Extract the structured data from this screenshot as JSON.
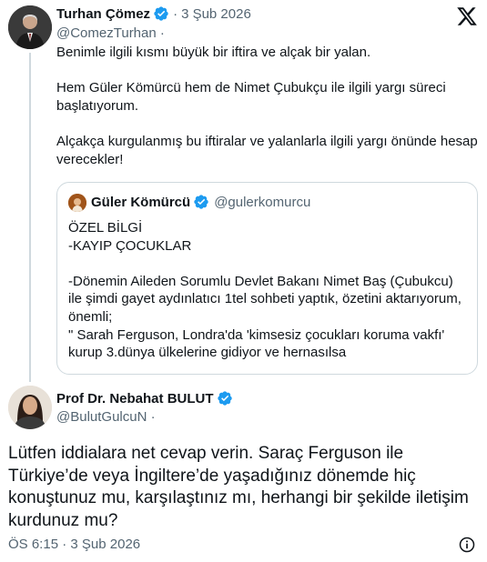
{
  "colors": {
    "verified_badge": "#1d9bf0",
    "text_primary": "#0f1419",
    "text_secondary": "#536471",
    "border": "#cfd9de"
  },
  "icons": {
    "verified": "verified-badge-icon",
    "platform": "x-logo-icon",
    "info": "info-icon"
  },
  "post": {
    "author_name": "Turhan Çömez",
    "dot": "·",
    "date": "3 Şub 2026",
    "handle": "@ComezTurhan",
    "handle_dot": "·",
    "paragraphs": [
      "Benimle ilgili kısmı büyük bir iftira ve alçak bir yalan.",
      "Hem Güler Kömürcü hem de Nimet Çubukçu ile ilgili yargı süreci başlatıyorum.",
      "Alçakça kurgulanmış bu iftiralar ve yalanlarla ilgili yargı önünde hesap verecekler!"
    ],
    "quote": {
      "author_name": "Güler Kömürcü",
      "handle": "@gulerkomurcu",
      "lines": [
        "ÖZEL BİLGİ",
        "-KAYIP ÇOCUKLAR",
        "-Dönemin Aileden Sorumlu Devlet Bakanı Nimet Baş (Çubukcu) ile şimdi gayet aydınlatıcı 1tel sohbeti yaptık, özetini aktarıyorum, önemli;",
        "\" Sarah Ferguson, Londra'da 'kimsesiz çocukları koruma vakfı' kurup 3.dünya ülkelerine gidiyor ve hernasılsa"
      ]
    }
  },
  "reply": {
    "author_name": "Prof Dr. Nebahat BULUT",
    "handle": "@BulutGulcuN",
    "handle_dot": "·",
    "text": "Lütfen iddialara net cevap verin. Saraç Ferguson ile Türkiye’de veya İngiltere’de yaşadığınız dönemde hiç konuştunuz mu, karşılaştınız mı, herhangi bir şekilde iletişim kurdunuz mu?",
    "time": "ÖS 6:15",
    "dot": "·",
    "date": "3 Şub 2026"
  }
}
